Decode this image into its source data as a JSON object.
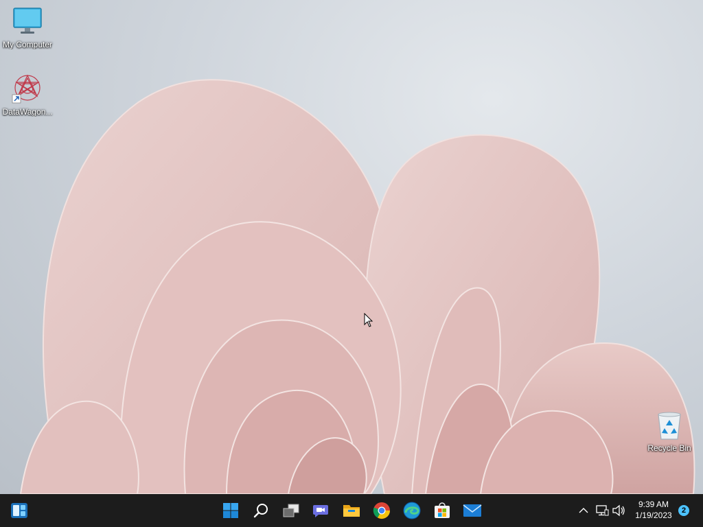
{
  "desktop": {
    "icons": [
      {
        "label": "My Computer",
        "icon": "monitor-icon"
      },
      {
        "label": "DataWagon...",
        "icon": "datawagon-shortcut-icon"
      },
      {
        "label": "Recycle Bin",
        "icon": "recycle-bin-icon"
      }
    ],
    "wallpaper": "windows-11-bloom-pink"
  },
  "taskbar": {
    "left_widget": "widgets-icon",
    "pinned": [
      {
        "name": "start-button",
        "icon": "windows-logo-icon"
      },
      {
        "name": "search-button",
        "icon": "search-icon"
      },
      {
        "name": "task-view-button",
        "icon": "task-view-icon"
      },
      {
        "name": "chat-button",
        "icon": "teams-chat-icon"
      },
      {
        "name": "file-explorer-button",
        "icon": "folder-icon"
      },
      {
        "name": "chrome-button",
        "icon": "chrome-icon"
      },
      {
        "name": "edge-button",
        "icon": "edge-icon"
      },
      {
        "name": "store-button",
        "icon": "store-icon"
      },
      {
        "name": "mail-button",
        "icon": "mail-icon"
      }
    ],
    "tray": {
      "time": "9:39 AM",
      "date": "1/19/2023",
      "notification_count": "2"
    }
  },
  "colors": {
    "taskbar": "#1c1c1c",
    "accent": "#0078d4",
    "wallpaper_pink": "#e6c4c2"
  }
}
